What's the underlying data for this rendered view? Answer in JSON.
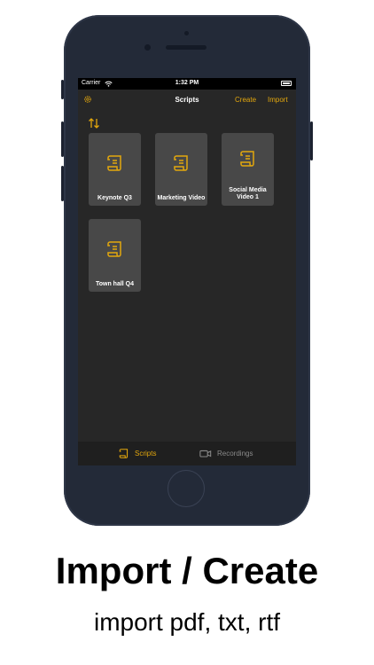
{
  "status_bar": {
    "carrier": "Carrier",
    "time": "1:32 PM"
  },
  "nav": {
    "title": "Scripts",
    "create_label": "Create",
    "import_label": "Import"
  },
  "scripts": [
    {
      "name": "Keynote Q3"
    },
    {
      "name": "Marketing Video"
    },
    {
      "name": "Social Media Video 1"
    },
    {
      "name": "Town hall Q4"
    }
  ],
  "tabs": [
    {
      "label": "Scripts",
      "active": true
    },
    {
      "label": "Recordings",
      "active": false
    }
  ],
  "caption": {
    "title": "Import / Create",
    "subtitle": "import pdf, txt, rtf"
  },
  "colors": {
    "accent": "#e3a70d",
    "background": "#272727",
    "card": "#484848",
    "phone_body": "#232a38",
    "tab_inactive": "#8a8a8a"
  },
  "icons": {
    "settings": "gear-icon",
    "sort": "sort-arrows-icon",
    "script": "scroll-icon",
    "recordings": "video-camera-icon",
    "wifi": "wifi-icon",
    "battery": "battery-icon"
  }
}
